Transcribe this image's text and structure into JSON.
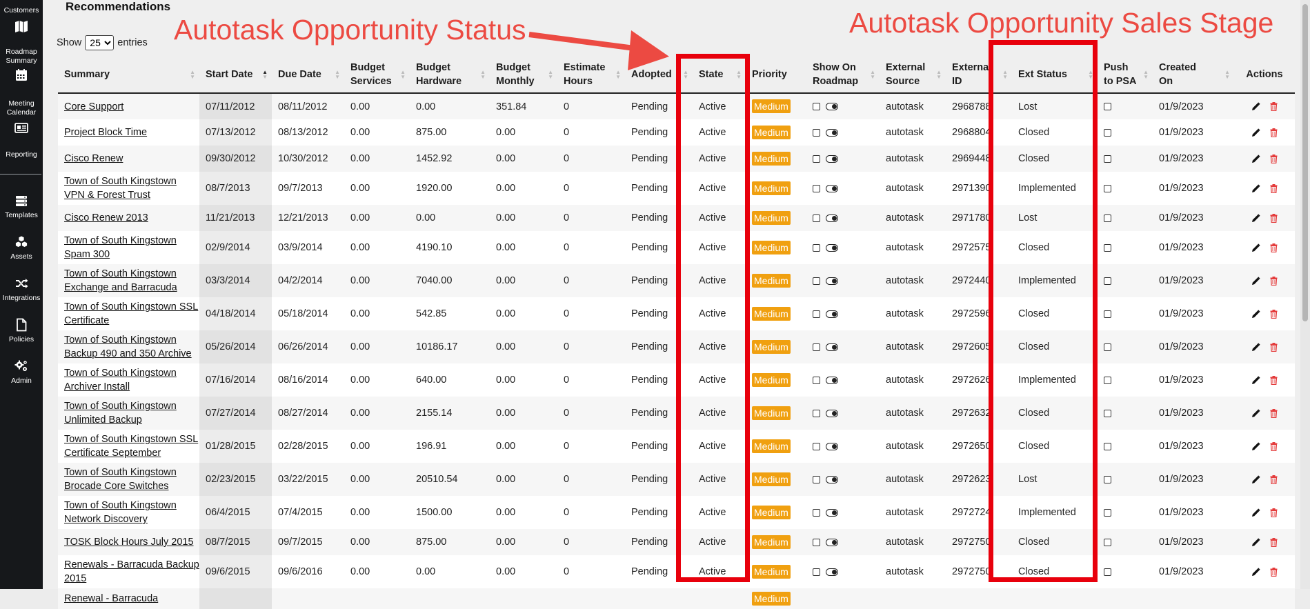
{
  "sidebar": {
    "items": [
      {
        "label": "Customers",
        "icon": "map-icon"
      },
      {
        "label": "Roadmap Summary",
        "icon": "calendar-icon"
      },
      {
        "label": "Meeting Calendar",
        "icon": "id-card-icon"
      },
      {
        "label": "Reporting",
        "icon": ""
      },
      {
        "label": "Templates",
        "icon": "server-icon"
      },
      {
        "label": "Assets",
        "icon": "cubes-icon"
      },
      {
        "label": "Integrations",
        "icon": "shuffle-icon"
      },
      {
        "label": "Policies",
        "icon": "document-icon"
      },
      {
        "label": "Admin",
        "icon": "gears-icon"
      }
    ]
  },
  "page": {
    "title": "Recommendations",
    "show_label": "Show",
    "entries_label": "entries",
    "page_size": "25"
  },
  "annotations": {
    "status": "Autotask Opportunity Status",
    "sales_stage": "Autotask Opportunity Sales Stage",
    "color": "#e8000c"
  },
  "table": {
    "columns": [
      "Summary",
      "Start Date",
      "Due Date",
      "Budget Services",
      "Budget Hardware",
      "Budget Monthly",
      "Estimate Hours",
      "Adopted",
      "State",
      "Priority",
      "Show On Roadmap",
      "External Source",
      "External ID",
      "Ext Status",
      "Push to PSA",
      "Created On",
      "Actions"
    ],
    "sorted_column": "Start Date",
    "rows": [
      {
        "summary": "Core Support",
        "start": "07/11/2012",
        "due": "08/11/2012",
        "services": "0.00",
        "hardware": "0.00",
        "monthly": "351.84",
        "hours": "0",
        "adopted": "Pending",
        "state": "Active",
        "priority": "Medium",
        "source": "autotask",
        "ext_id": "2968788",
        "ext_status": "Lost",
        "created": "01/9/2023"
      },
      {
        "summary": "Project Block Time",
        "start": "07/13/2012",
        "due": "08/13/2012",
        "services": "0.00",
        "hardware": "875.00",
        "monthly": "0.00",
        "hours": "0",
        "adopted": "Pending",
        "state": "Active",
        "priority": "Medium",
        "source": "autotask",
        "ext_id": "2968804",
        "ext_status": "Closed",
        "created": "01/9/2023"
      },
      {
        "summary": "Cisco Renew",
        "start": "09/30/2012",
        "due": "10/30/2012",
        "services": "0.00",
        "hardware": "1452.92",
        "monthly": "0.00",
        "hours": "0",
        "adopted": "Pending",
        "state": "Active",
        "priority": "Medium",
        "source": "autotask",
        "ext_id": "2969448",
        "ext_status": "Closed",
        "created": "01/9/2023"
      },
      {
        "summary": "Town of South Kingstown VPN & Forest Trust",
        "start": "08/7/2013",
        "due": "09/7/2013",
        "services": "0.00",
        "hardware": "1920.00",
        "monthly": "0.00",
        "hours": "0",
        "adopted": "Pending",
        "state": "Active",
        "priority": "Medium",
        "source": "autotask",
        "ext_id": "2971390",
        "ext_status": "Implemented",
        "created": "01/9/2023"
      },
      {
        "summary": "Cisco Renew 2013",
        "start": "11/21/2013",
        "due": "12/21/2013",
        "services": "0.00",
        "hardware": "0.00",
        "monthly": "0.00",
        "hours": "0",
        "adopted": "Pending",
        "state": "Active",
        "priority": "Medium",
        "source": "autotask",
        "ext_id": "2971780",
        "ext_status": "Lost",
        "created": "01/9/2023"
      },
      {
        "summary": "Town of South Kingstown Spam 300",
        "start": "02/9/2014",
        "due": "03/9/2014",
        "services": "0.00",
        "hardware": "4190.10",
        "monthly": "0.00",
        "hours": "0",
        "adopted": "Pending",
        "state": "Active",
        "priority": "Medium",
        "source": "autotask",
        "ext_id": "2972575",
        "ext_status": "Closed",
        "created": "01/9/2023"
      },
      {
        "summary": "Town of South Kingstown Exchange and Barracuda",
        "start": "03/3/2014",
        "due": "04/2/2014",
        "services": "0.00",
        "hardware": "7040.00",
        "monthly": "0.00",
        "hours": "0",
        "adopted": "Pending",
        "state": "Active",
        "priority": "Medium",
        "source": "autotask",
        "ext_id": "2972440",
        "ext_status": "Implemented",
        "created": "01/9/2023"
      },
      {
        "summary": "Town of South Kingstown SSL Certificate",
        "start": "04/18/2014",
        "due": "05/18/2014",
        "services": "0.00",
        "hardware": "542.85",
        "monthly": "0.00",
        "hours": "0",
        "adopted": "Pending",
        "state": "Active",
        "priority": "Medium",
        "source": "autotask",
        "ext_id": "2972596",
        "ext_status": "Closed",
        "created": "01/9/2023"
      },
      {
        "summary": "Town of South Kingstown Backup 490 and 350 Archive",
        "start": "05/26/2014",
        "due": "06/26/2014",
        "services": "0.00",
        "hardware": "10186.17",
        "monthly": "0.00",
        "hours": "0",
        "adopted": "Pending",
        "state": "Active",
        "priority": "Medium",
        "source": "autotask",
        "ext_id": "2972605",
        "ext_status": "Closed",
        "created": "01/9/2023"
      },
      {
        "summary": "Town of South Kingstown Archiver Install",
        "start": "07/16/2014",
        "due": "08/16/2014",
        "services": "0.00",
        "hardware": "640.00",
        "monthly": "0.00",
        "hours": "0",
        "adopted": "Pending",
        "state": "Active",
        "priority": "Medium",
        "source": "autotask",
        "ext_id": "2972626",
        "ext_status": "Implemented",
        "created": "01/9/2023"
      },
      {
        "summary": "Town of South Kingstown Unlimited Backup",
        "start": "07/27/2014",
        "due": "08/27/2014",
        "services": "0.00",
        "hardware": "2155.14",
        "monthly": "0.00",
        "hours": "0",
        "adopted": "Pending",
        "state": "Active",
        "priority": "Medium",
        "source": "autotask",
        "ext_id": "2972632",
        "ext_status": "Closed",
        "created": "01/9/2023"
      },
      {
        "summary": "Town of South Kingstown SSL Certificate September",
        "start": "01/28/2015",
        "due": "02/28/2015",
        "services": "0.00",
        "hardware": "196.91",
        "monthly": "0.00",
        "hours": "0",
        "adopted": "Pending",
        "state": "Active",
        "priority": "Medium",
        "source": "autotask",
        "ext_id": "2972650",
        "ext_status": "Closed",
        "created": "01/9/2023"
      },
      {
        "summary": "Town of South Kingstown Brocade Core Switches",
        "start": "02/23/2015",
        "due": "03/22/2015",
        "services": "0.00",
        "hardware": "20510.54",
        "monthly": "0.00",
        "hours": "0",
        "adopted": "Pending",
        "state": "Active",
        "priority": "Medium",
        "source": "autotask",
        "ext_id": "2972623",
        "ext_status": "Lost",
        "created": "01/9/2023"
      },
      {
        "summary": "Town of South Kingstown Network Discovery",
        "start": "06/4/2015",
        "due": "07/4/2015",
        "services": "0.00",
        "hardware": "1500.00",
        "monthly": "0.00",
        "hours": "0",
        "adopted": "Pending",
        "state": "Active",
        "priority": "Medium",
        "source": "autotask",
        "ext_id": "2972724",
        "ext_status": "Implemented",
        "created": "01/9/2023"
      },
      {
        "summary": "TOSK Block Hours July 2015",
        "start": "08/7/2015",
        "due": "09/7/2015",
        "services": "0.00",
        "hardware": "875.00",
        "monthly": "0.00",
        "hours": "0",
        "adopted": "Pending",
        "state": "Active",
        "priority": "Medium",
        "source": "autotask",
        "ext_id": "2972750",
        "ext_status": "Closed",
        "created": "01/9/2023"
      },
      {
        "summary": "Renewals - Barracuda Backup 2015",
        "start": "09/6/2015",
        "due": "09/6/2016",
        "services": "0.00",
        "hardware": "0.00",
        "monthly": "0.00",
        "hours": "0",
        "adopted": "Pending",
        "state": "Active",
        "priority": "Medium",
        "source": "autotask",
        "ext_id": "2972750",
        "ext_status": "Closed",
        "created": "01/9/2023"
      },
      {
        "summary": "Renewal - Barracuda",
        "start": "",
        "due": "",
        "services": "",
        "hardware": "",
        "monthly": "",
        "hours": "",
        "adopted": "",
        "state": "",
        "priority": "Medium",
        "source": "",
        "ext_id": "",
        "ext_status": "",
        "created": ""
      }
    ]
  }
}
